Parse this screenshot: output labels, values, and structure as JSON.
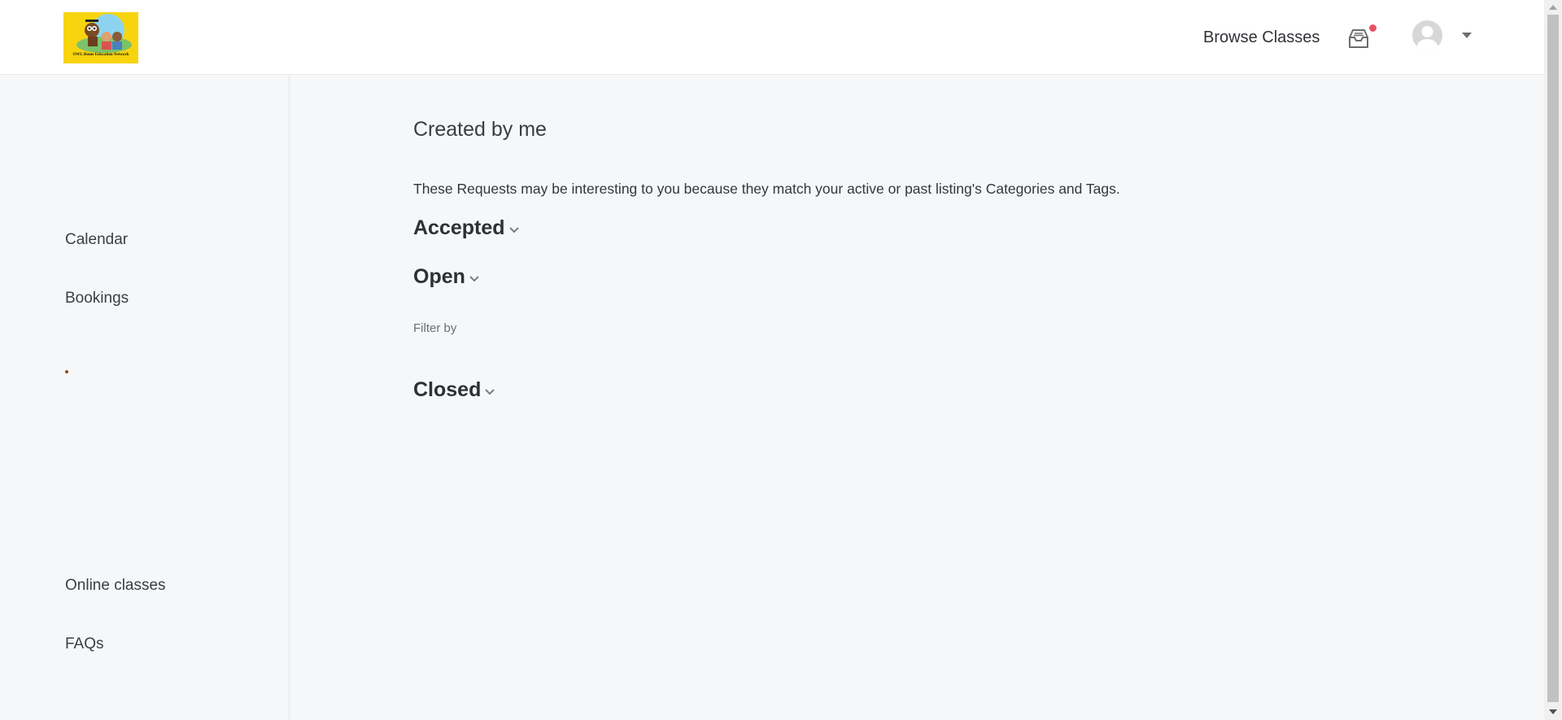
{
  "header": {
    "logo_text": "OWL Home Education Network",
    "browse_label": "Browse Classes"
  },
  "sidebar": {
    "items": [
      {
        "label": "Calendar"
      },
      {
        "label": "Bookings"
      },
      {
        "label": "Online classes"
      },
      {
        "label": "FAQs"
      }
    ]
  },
  "main": {
    "title": "Created by me",
    "intro": "These Requests may be interesting to you because they match your active or past listing's Categories and Tags.",
    "sections": [
      {
        "label": "Accepted"
      },
      {
        "label": "Open"
      },
      {
        "label": "Closed"
      }
    ],
    "filter_label": "Filter by"
  },
  "colors": {
    "notification": "#e45566",
    "logo_background": "#f7d40e"
  }
}
